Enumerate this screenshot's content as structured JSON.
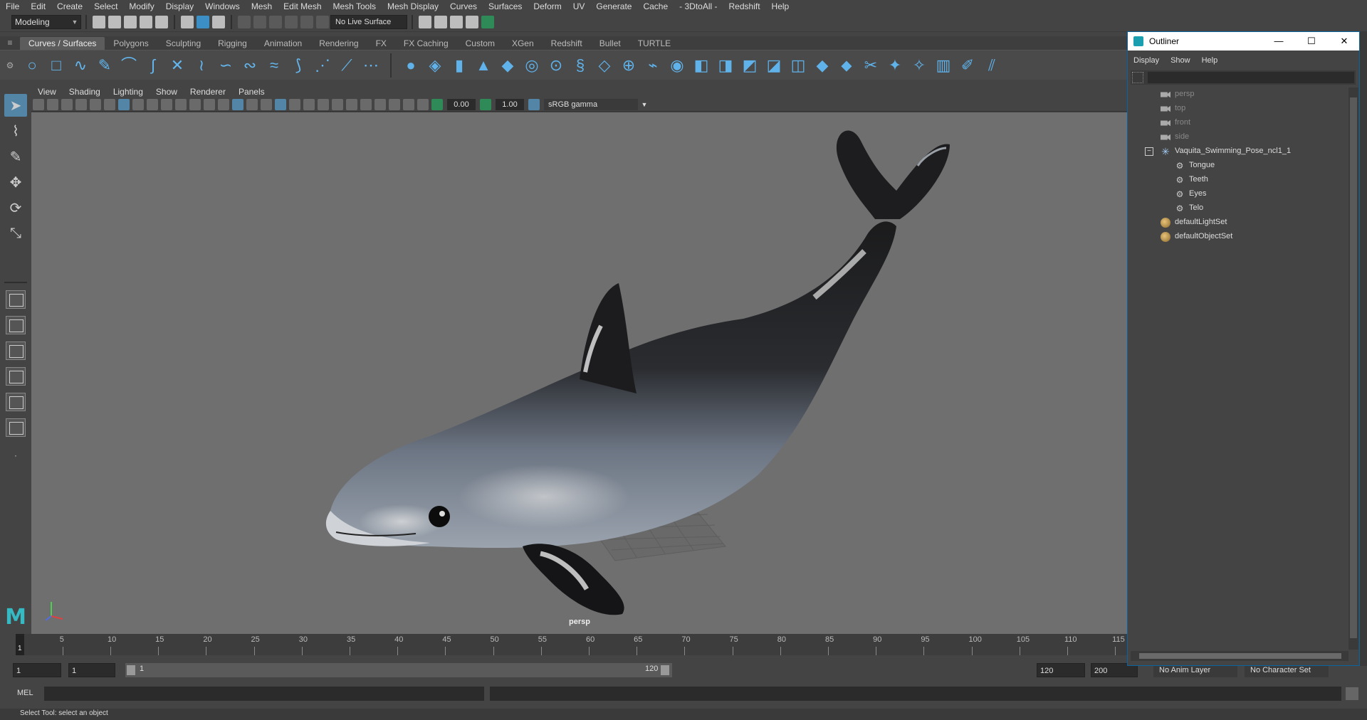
{
  "menubar": {
    "items": [
      "File",
      "Edit",
      "Create",
      "Select",
      "Modify",
      "Display",
      "Windows",
      "Mesh",
      "Edit Mesh",
      "Mesh Tools",
      "Mesh Display",
      "Curves",
      "Surfaces",
      "Deform",
      "UV",
      "Generate",
      "Cache",
      "- 3DtoAll -",
      "Redshift",
      "Help"
    ]
  },
  "statusline": {
    "mode": "Modeling",
    "live_surface": "No Live Surface"
  },
  "shelf": {
    "tabs": [
      "Curves / Surfaces",
      "Polygons",
      "Sculpting",
      "Rigging",
      "Animation",
      "Rendering",
      "FX",
      "FX Caching",
      "Custom",
      "XGen",
      "Redshift",
      "Bullet",
      "TURTLE"
    ],
    "active_tab": "Curves / Surfaces"
  },
  "panel": {
    "menu": [
      "View",
      "Shading",
      "Lighting",
      "Show",
      "Renderer",
      "Panels"
    ],
    "exposure": "0.00",
    "gamma": "1.00",
    "color_space": "sRGB gamma",
    "camera_label": "persp"
  },
  "timeline": {
    "ticks": [
      5,
      10,
      15,
      20,
      25,
      30,
      35,
      40,
      45,
      50,
      55,
      60,
      65,
      70,
      75,
      80,
      85,
      90,
      95,
      100,
      105,
      110,
      115
    ],
    "current_frame": "1"
  },
  "range": {
    "start": "1",
    "anim_start": "1",
    "slider_start": "1",
    "slider_end": "120",
    "end": "120",
    "anim_end": "200",
    "anim_layer": "No Anim Layer",
    "character_set": "No Character Set"
  },
  "cmdline": {
    "lang": "MEL",
    "help": "Select Tool: select an object"
  },
  "outliner": {
    "title": "Outliner",
    "menu": [
      "Display",
      "Show",
      "Help"
    ],
    "cameras": [
      "persp",
      "top",
      "front",
      "side"
    ],
    "group": "Vaquita_Swimming_Pose_ncl1_1",
    "children": [
      "Tongue",
      "Teeth",
      "Eyes",
      "Telo"
    ],
    "sets": [
      "defaultLightSet",
      "defaultObjectSet"
    ]
  }
}
